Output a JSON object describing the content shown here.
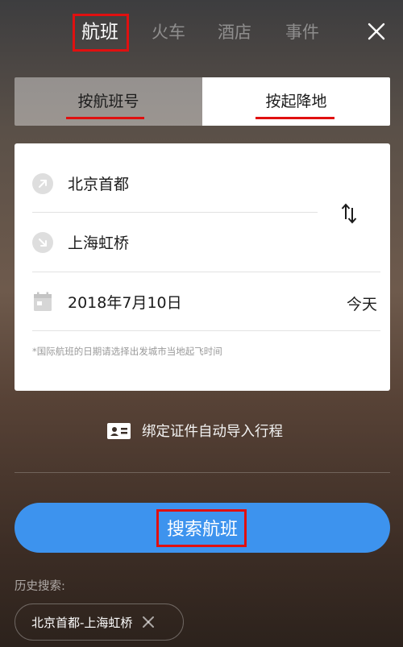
{
  "tabs": [
    {
      "label": "航班"
    },
    {
      "label": "火车"
    },
    {
      "label": "酒店"
    },
    {
      "label": "事件"
    }
  ],
  "close_icon": "close-icon",
  "search_mode": {
    "options": [
      {
        "label": "按航班号"
      },
      {
        "label": "按起降地"
      }
    ],
    "selected": "按起降地"
  },
  "search_form": {
    "departure": "北京首都",
    "arrival": "上海虹桥",
    "date": "2018年7月10日",
    "day_label": "今天",
    "note": "*国际航班的日期请选择出发城市当地起飞时间"
  },
  "bind_id": {
    "label": "绑定证件自动导入行程"
  },
  "search_button": {
    "label": "搜索航班"
  },
  "history": {
    "label": "历史搜索:",
    "items": [
      {
        "route": "北京首都-上海虹桥"
      }
    ]
  },
  "colors": {
    "accent_blue": "#3d93ee",
    "highlight_red": "#e01010",
    "card_bg": "#ffffff"
  }
}
